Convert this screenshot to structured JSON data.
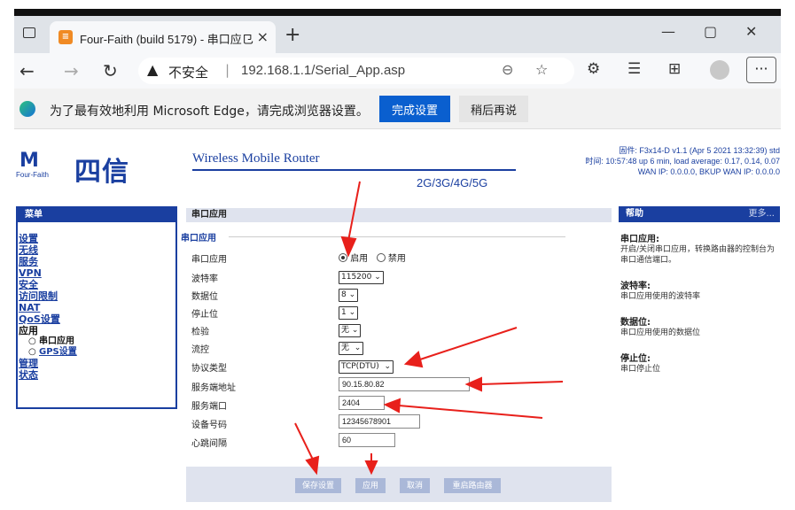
{
  "browser": {
    "tab": {
      "title": "Four-Faith (build 5179) - 串口应⺋"
    },
    "address": {
      "security": "不安全",
      "separator": "|",
      "url": "192.168.1.1/Serial_App.asp"
    },
    "window_controls": {
      "minimize": "—",
      "maximize": "▢",
      "close": "✕"
    },
    "infobar": {
      "message": "为了最有效地利用 Microsoft Edge，请完成浏览器设置。",
      "primary_button": "完成设置",
      "secondary_button": "稍后再说"
    },
    "icons": [
      "back-icon",
      "forward-icon",
      "refresh-icon",
      "warning-icon",
      "zoom-icon",
      "add-favorite-icon",
      "extensions-icon",
      "favorites-icon",
      "collections-icon",
      "profile-icon",
      "more-icon"
    ]
  },
  "router": {
    "logo": {
      "symbol": "M",
      "brand_en": "Four-Faith",
      "brand_cn": "四信"
    },
    "product": {
      "name": "Wireless Mobile Router",
      "bands": "2G/3G/4G/5G"
    },
    "sysinfo": {
      "firmware": "固件: F3x14-D v1.1 (Apr 5 2021 13:32:39) std",
      "uptime": "时间: 10:57:48 up 6 min, load average: 0.17, 0.14, 0.07",
      "wan": "WAN IP: 0.0.0.0, BKUP WAN IP: 0.0.0.0"
    },
    "menu": {
      "header": "菜单",
      "items": [
        {
          "label": "设置"
        },
        {
          "label": "无线"
        },
        {
          "label": "服务"
        },
        {
          "label": "VPN"
        },
        {
          "label": "安全"
        },
        {
          "label": "访问限制"
        },
        {
          "label": "NAT"
        },
        {
          "label": "QoS设置"
        },
        {
          "label": "应用"
        }
      ],
      "subitems": [
        {
          "label": "串口应用",
          "current": true
        },
        {
          "label": "GPS设置",
          "current": false
        }
      ],
      "items_after": [
        {
          "label": "管理"
        },
        {
          "label": "状态"
        }
      ],
      "bullet": "○"
    },
    "content": {
      "header": "串口应用",
      "legend": "串口应用",
      "fields": {
        "serial_app": {
          "label": "串口应用",
          "option_on": "启用",
          "option_off": "禁用",
          "selected": "启用"
        },
        "baud_rate": {
          "label": "波特率",
          "value": "115200"
        },
        "data_bits": {
          "label": "数据位",
          "value": "8"
        },
        "stop_bits": {
          "label": "停止位",
          "value": "1"
        },
        "parity": {
          "label": "检验",
          "value": "无"
        },
        "flow_control": {
          "label": "流控",
          "value": "无"
        },
        "protocol": {
          "label": "协议类型",
          "value": "TCP(DTU)"
        },
        "server_address": {
          "label": "服务端地址",
          "value": "90.15.80.82"
        },
        "server_port": {
          "label": "服务端口",
          "value": "2404"
        },
        "device_id": {
          "label": "设备号码",
          "value": "12345678901"
        },
        "heartbeat": {
          "label": "心跳间隔",
          "value": "60"
        }
      },
      "buttons": {
        "save": "保存设置",
        "apply": "应用",
        "cancel": "取消",
        "reboot": "重启路由器"
      }
    },
    "help": {
      "header": "帮助",
      "more": "更多...",
      "sections": [
        {
          "title": "串口应用:",
          "text": "开启/关闭串口应用，转换路由器的控制台为串口通信端口。"
        },
        {
          "title": "波特率:",
          "text": "串口应用使用的波特率"
        },
        {
          "title": "数据位:",
          "text": "串口应用使用的数据位"
        },
        {
          "title": "停止位:",
          "text": "串口停止位"
        }
      ]
    }
  },
  "colors": {
    "brand": "#1a3fa0",
    "arrow": "#e8201b",
    "edge_button": "#0a5fcf"
  }
}
